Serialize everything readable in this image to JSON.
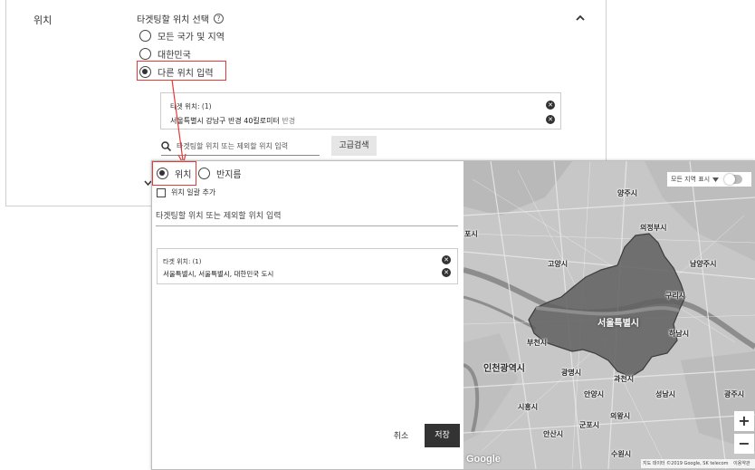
{
  "back_panel": {
    "section_label": "위치",
    "targeting_title": "타겟팅할 위치 선택",
    "help_icon": "?",
    "collapse_icon": "^",
    "options": [
      {
        "label": "모든 국가 및 지역",
        "selected": false
      },
      {
        "label": "대한민국",
        "selected": false
      },
      {
        "label": "다른 위치 입력",
        "selected": true
      }
    ],
    "target_summary": {
      "header": "타겟 위치: (1)",
      "location_main": "서울특별시 강남구 반경 40킬로미터",
      "location_suffix": "반경"
    },
    "search_placeholder": "타겟팅할 위치 또는 제외할 위치 입력",
    "advanced_search_label": "고급검색",
    "expand_icon": "⌄"
  },
  "front_panel": {
    "mode_options": [
      {
        "label": "위치",
        "selected": true
      },
      {
        "label": "반지름",
        "selected": false
      }
    ],
    "bulk_add_label": "위치 일괄 추가",
    "location_input_placeholder": "타겟팅할 위치 또는 제외할 위치 입력",
    "target_summary": {
      "header": "타겟 위치: (1)",
      "location": "서울특별시, 서울특별시, 대한민국 도시"
    },
    "cancel_label": "취소",
    "save_label": "저장"
  },
  "map": {
    "show_all_regions_label": "모든 지역 표시",
    "show_all_regions_on": false,
    "zoom_in": "+",
    "zoom_out": "−",
    "logo": "Google",
    "attribution": "지도 데이터 ©2019 Google, SK telecom",
    "terms": "이용약관",
    "labels": {
      "yangju": "양주시",
      "uijeongbu": "의정부시",
      "goyang": "고양시",
      "namyangju": "남양주시",
      "guri": "구리시",
      "seoul": "서울특별시",
      "hanam": "하남시",
      "bucheon": "부천시",
      "incheon": "인천광역시",
      "gwangmyeong": "광명시",
      "gwacheon": "과천시",
      "seongnam": "성남시",
      "gwangju": "광주시",
      "anyang": "안양시",
      "siheung": "시흥시",
      "uiwang": "의왕시",
      "gunpo": "군포시",
      "ansan": "안산시",
      "suwon": "수원시",
      "po": "포시"
    },
    "colors": {
      "seoul_fill": "#5f5f5f",
      "map_bg": "#c9c9c9",
      "river": "#8a8a8a"
    }
  },
  "highlight_color": "#e53935"
}
